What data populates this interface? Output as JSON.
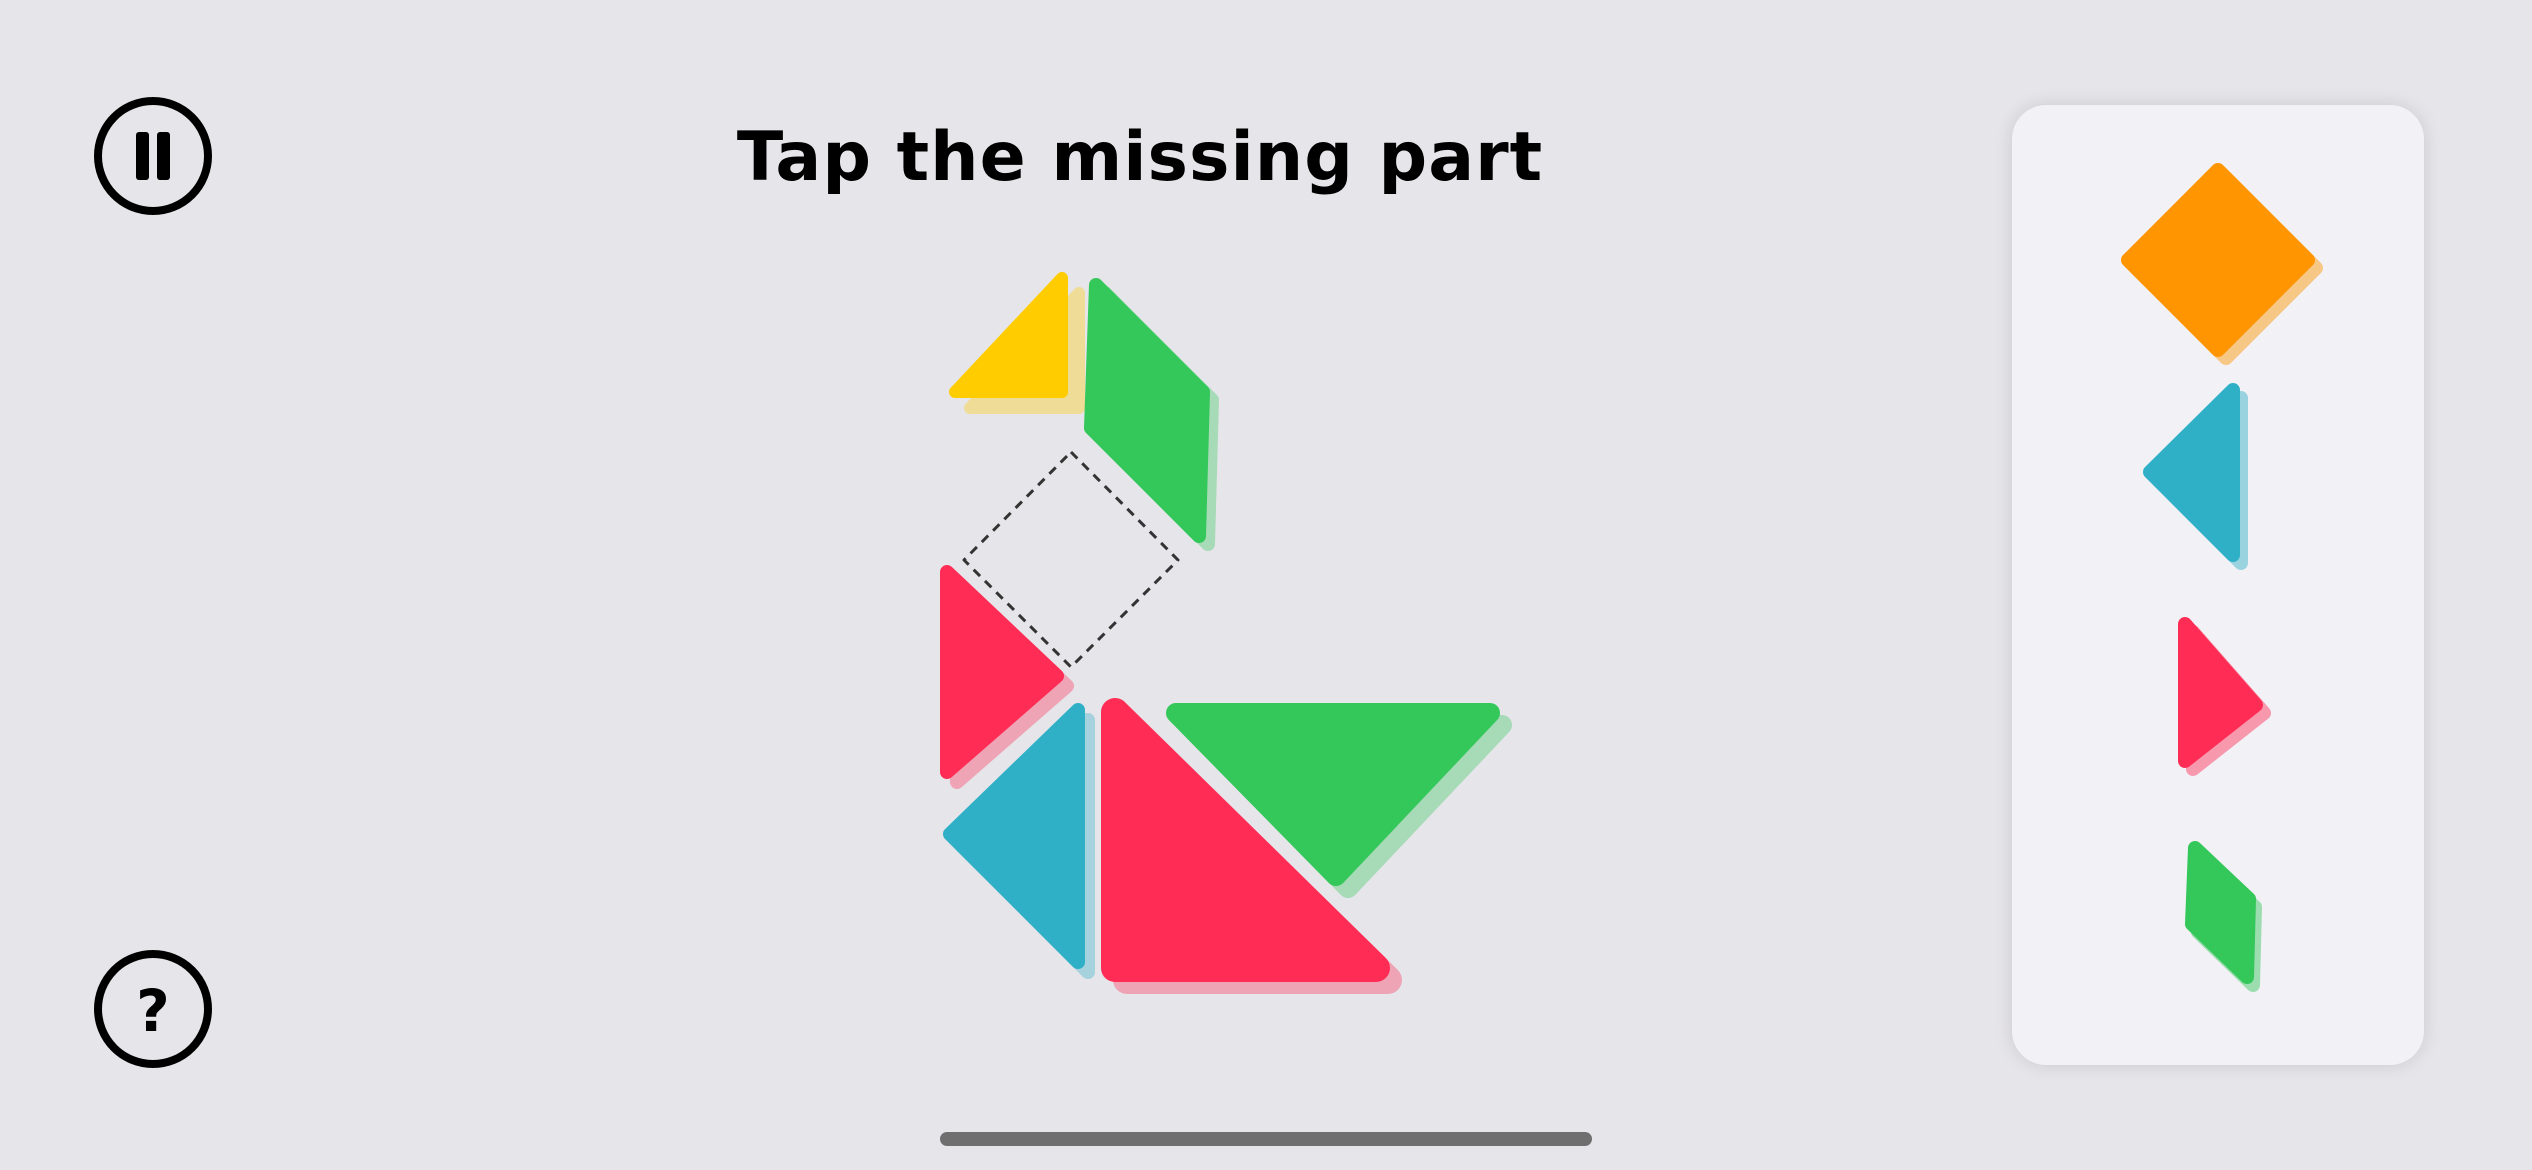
{
  "game": {
    "instruction": "Tap the missing part"
  },
  "controls": {
    "pause_icon": "pause-icon",
    "help_icon": "question-mark-icon",
    "help_glyph": "?"
  },
  "colors": {
    "background": "#e6e5ea",
    "tray": "#f2f1f6",
    "yellow": "#ffcc00",
    "green": "#34c759",
    "red": "#ff2d55",
    "blue": "#30b0c7",
    "orange": "#ff9500"
  },
  "puzzle": {
    "pieces": [
      "yellow-triangle",
      "green-parallelogram",
      "red-triangle-small",
      "blue-triangle",
      "red-triangle-large",
      "green-triangle-large"
    ],
    "missing_slot": "square"
  },
  "tray": {
    "options": [
      "orange-square",
      "blue-triangle",
      "red-triangle",
      "green-parallelogram"
    ]
  }
}
